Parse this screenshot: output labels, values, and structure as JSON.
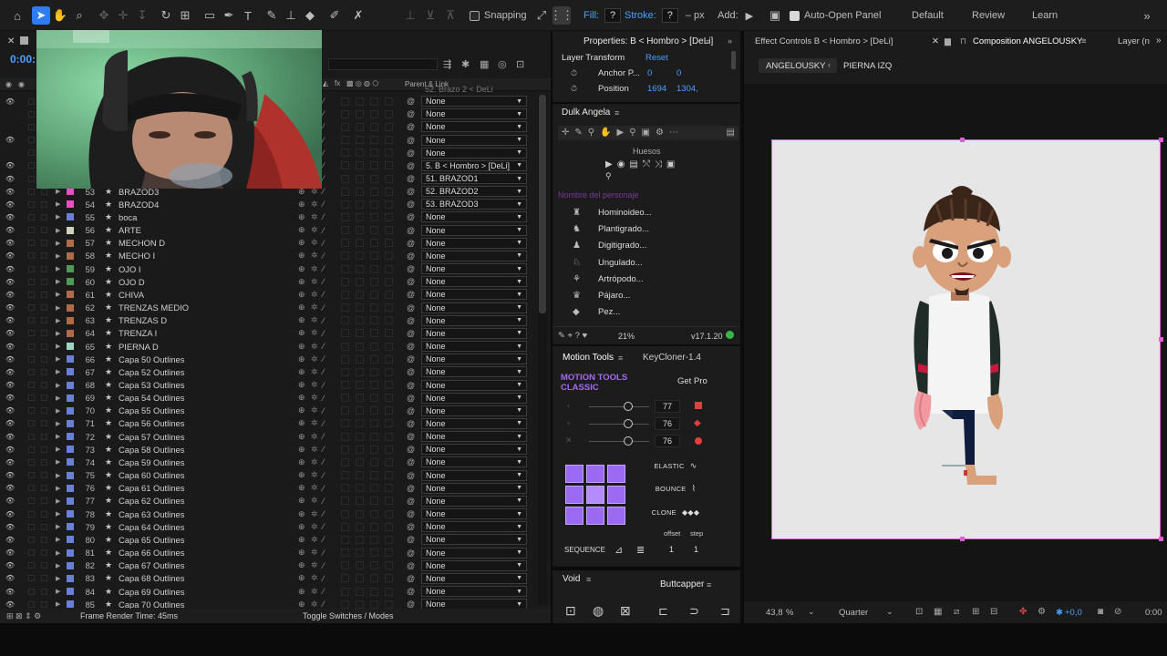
{
  "toolbar": {
    "snapping_label": "Snapping",
    "fill_label": "Fill:",
    "fill_value": "?",
    "stroke_label": "Stroke:",
    "stroke_value": "?",
    "stroke_unit": "– px",
    "add_label": "Add:",
    "auto_open_label": "Auto-Open Panel",
    "workspaces": [
      "Default",
      "Review",
      "Learn"
    ]
  },
  "timeline": {
    "time_display": "0:00:",
    "column_parent": "Parent & Link",
    "partial_top_row": "52. Brazo 2 < DeLi",
    "layers": [
      {
        "num": "",
        "name": "",
        "parent": "None",
        "color": "#b25d5d",
        "eye": true
      },
      {
        "num": "",
        "name": "",
        "parent": "None",
        "color": "#b25d5d",
        "eye": false
      },
      {
        "num": "",
        "name": "",
        "parent": "None",
        "color": "#b25d5d",
        "eye": false
      },
      {
        "num": "",
        "name": "",
        "parent": "None",
        "color": "#b25d5d",
        "eye": true
      },
      {
        "num": "",
        "name": "",
        "parent": "None",
        "color": "#b25d5d",
        "eye": false
      },
      {
        "num": "",
        "name": "",
        "parent": "5. B < Hombro > [DeLi]",
        "color": "#b25d5d",
        "eye": true
      },
      {
        "num": "",
        "name": "",
        "parent": "51. BRAZOD1",
        "color": "#b25d5d",
        "eye": true
      },
      {
        "num": "53",
        "name": "BRAZOD3",
        "parent": "52. BRAZOD2",
        "color": "#e94fc0",
        "eye": true
      },
      {
        "num": "54",
        "name": "BRAZOD4",
        "parent": "53. BRAZOD3",
        "color": "#e94fc0",
        "eye": true
      },
      {
        "num": "55",
        "name": "boca",
        "parent": "None",
        "color": "#6a7fd6",
        "eye": true
      },
      {
        "num": "56",
        "name": "ARTE",
        "parent": "None",
        "color": "#cfd1b8",
        "eye": true
      },
      {
        "num": "57",
        "name": "MECHON D",
        "parent": "None",
        "color": "#b06a4a",
        "eye": true
      },
      {
        "num": "58",
        "name": "MECHO I",
        "parent": "None",
        "color": "#b06a4a",
        "eye": true
      },
      {
        "num": "59",
        "name": "OJO I",
        "parent": "None",
        "color": "#4e9a54",
        "eye": true
      },
      {
        "num": "60",
        "name": "OJO D",
        "parent": "None",
        "color": "#4e9a54",
        "eye": true
      },
      {
        "num": "61",
        "name": "CHIVA",
        "parent": "None",
        "color": "#b06a4a",
        "eye": true
      },
      {
        "num": "62",
        "name": "TRENZAS MEDIO",
        "parent": "None",
        "color": "#b06a4a",
        "eye": true
      },
      {
        "num": "63",
        "name": "TRENZAS D",
        "parent": "None",
        "color": "#b06a4a",
        "eye": true
      },
      {
        "num": "64",
        "name": "TRENZA I",
        "parent": "None",
        "color": "#b06a4a",
        "eye": true
      },
      {
        "num": "65",
        "name": "PIERNA D",
        "parent": "None",
        "color": "#9fd3c2",
        "eye": true
      },
      {
        "num": "66",
        "name": "Capa 50 Outlines",
        "parent": "None",
        "color": "#6a7fd6",
        "eye": true
      },
      {
        "num": "67",
        "name": "Capa 52 Outlines",
        "parent": "None",
        "color": "#6a7fd6",
        "eye": true
      },
      {
        "num": "68",
        "name": "Capa 53 Outlines",
        "parent": "None",
        "color": "#6a7fd6",
        "eye": true
      },
      {
        "num": "69",
        "name": "Capa 54 Outlines",
        "parent": "None",
        "color": "#6a7fd6",
        "eye": true
      },
      {
        "num": "70",
        "name": "Capa 55 Outlines",
        "parent": "None",
        "color": "#6a7fd6",
        "eye": true
      },
      {
        "num": "71",
        "name": "Capa 56 Outlines",
        "parent": "None",
        "color": "#6a7fd6",
        "eye": true
      },
      {
        "num": "72",
        "name": "Capa 57 Outlines",
        "parent": "None",
        "color": "#6a7fd6",
        "eye": true
      },
      {
        "num": "73",
        "name": "Capa 58 Outlines",
        "parent": "None",
        "color": "#6a7fd6",
        "eye": true
      },
      {
        "num": "74",
        "name": "Capa 59 Outlines",
        "parent": "None",
        "color": "#6a7fd6",
        "eye": true
      },
      {
        "num": "75",
        "name": "Capa 60 Outlines",
        "parent": "None",
        "color": "#6a7fd6",
        "eye": true
      },
      {
        "num": "76",
        "name": "Capa 61 Outlines",
        "parent": "None",
        "color": "#6a7fd6",
        "eye": true
      },
      {
        "num": "77",
        "name": "Capa 62 Outlines",
        "parent": "None",
        "color": "#6a7fd6",
        "eye": true
      },
      {
        "num": "78",
        "name": "Capa 63 Outlines",
        "parent": "None",
        "color": "#6a7fd6",
        "eye": true
      },
      {
        "num": "79",
        "name": "Capa 64 Outlines",
        "parent": "None",
        "color": "#6a7fd6",
        "eye": true
      },
      {
        "num": "80",
        "name": "Capa 65 Outlines",
        "parent": "None",
        "color": "#6a7fd6",
        "eye": true
      },
      {
        "num": "81",
        "name": "Capa 66 Outlines",
        "parent": "None",
        "color": "#6a7fd6",
        "eye": true
      },
      {
        "num": "82",
        "name": "Capa 67 Outlines",
        "parent": "None",
        "color": "#6a7fd6",
        "eye": true
      },
      {
        "num": "83",
        "name": "Capa 68 Outlines",
        "parent": "None",
        "color": "#6a7fd6",
        "eye": true
      },
      {
        "num": "84",
        "name": "Capa 69 Outlines",
        "parent": "None",
        "color": "#6a7fd6",
        "eye": true
      },
      {
        "num": "85",
        "name": "Capa 70 Outlines",
        "parent": "None",
        "color": "#6a7fd6",
        "eye": true
      }
    ]
  },
  "statusbar": {
    "frame_render_time": "Frame Render Time:  45ms",
    "toggle_label": "Toggle Switches / Modes"
  },
  "properties": {
    "title": "Properties: B < Hombro > [DeLi]",
    "section": "Layer Transform",
    "reset_label": "Reset",
    "anchor_label": "Anchor P...",
    "anchor_x": "0",
    "anchor_y": "0",
    "position_label": "Position",
    "position_x": "1694",
    "position_y": "1304,"
  },
  "dulk": {
    "title": "Dulk Angela",
    "huesos_label": "Huesos",
    "character_name_placeholder": "Nombre del personaje",
    "characters": [
      "Hominoideo...",
      "Plantigrado...",
      "Digitigrado...",
      "Ungulado...",
      "Artrópodo...",
      "Pájaro...",
      "Pez..."
    ],
    "zoom": "21%",
    "version": "v17.1.20"
  },
  "motion_tools": {
    "tab1": "Motion Tools",
    "tab2": "KeyCloner-1.4",
    "brand_line1": "MOTION TOOLS",
    "brand_line2": "CLASSIC",
    "get_pro_label": "Get Pro",
    "values": [
      "77",
      "76",
      "76"
    ],
    "elastic_label": "ELASTIC",
    "bounce_label": "BOUNCE",
    "clone_label": "CLONE",
    "sequence_label": "SEQUENCE",
    "offset_label": "offset",
    "step_label": "step",
    "offset_value": "1",
    "step_value": "1"
  },
  "void_panel": {
    "tab1": "Void",
    "tab2": "Buttcapper"
  },
  "composition": {
    "effect_controls_tab": "Effect Controls B < Hombro > [DeLi]",
    "comp_tab": "Composition ANGELOUSKY",
    "layer_tab": "Layer (n",
    "breadcrumb1": "ANGELOUSKY",
    "breadcrumb2": "PIERNA IZQ",
    "zoom": "43,8",
    "zoom_unit": "%",
    "resolution": "Quarter",
    "exposure": "+0,0",
    "time": "0:00"
  }
}
